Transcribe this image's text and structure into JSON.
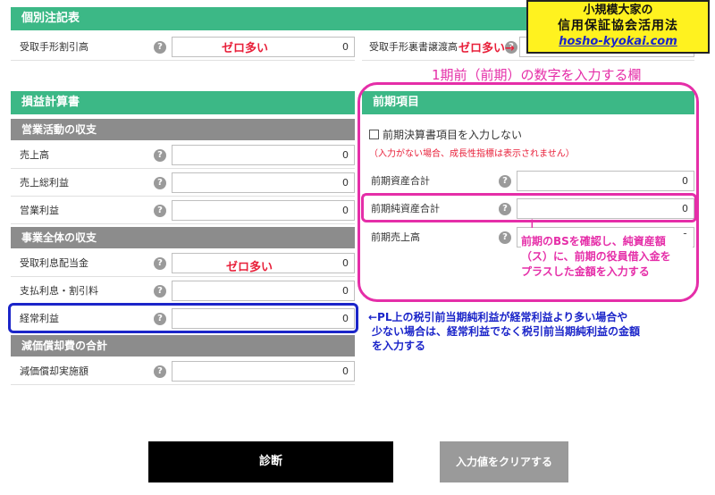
{
  "banner": {
    "line1": "小規模大家の",
    "line2": "信用保証協会活用法",
    "url": "hosho-kyokai.com"
  },
  "notes_section": {
    "title": "個別注記表",
    "rows": [
      {
        "label": "受取手形割引高",
        "value": "0",
        "annotation": "ゼロ多い"
      },
      {
        "label": "受取手形裏書譲渡高",
        "value": "",
        "annotation": "ゼロ多い"
      }
    ]
  },
  "income_statement": {
    "title": "損益計算書",
    "operating_header": "営業活動の収支",
    "operating_rows": [
      {
        "label": "売上高",
        "value": "0"
      },
      {
        "label": "売上総利益",
        "value": "0"
      },
      {
        "label": "営業利益",
        "value": "0"
      }
    ],
    "business_header": "事業全体の収支",
    "business_rows": [
      {
        "label": "受取利息配当金",
        "value": "0",
        "annotation": "ゼロ多い"
      },
      {
        "label": "支払利息・割引料",
        "value": "0"
      },
      {
        "label": "経常利益",
        "value": "0"
      }
    ],
    "depreciation_header": "減価償却費の合計",
    "depreciation_rows": [
      {
        "label": "減価償却実施額",
        "value": "0"
      }
    ]
  },
  "prior_period": {
    "caption": "1期前（前期）の数字を入力する欄",
    "title": "前期項目",
    "checkbox_label": "前期決算書項目を入力しない",
    "checkbox_note": "（入力がない場合、成長性指標は表示されません）",
    "rows": [
      {
        "label": "前期資産合計",
        "value": "0"
      },
      {
        "label": "前期純資産合計",
        "value": "0"
      },
      {
        "label": "前期売上高",
        "value": "0"
      }
    ],
    "arrow": "↑",
    "annotation_lines": [
      "前期のBSを確認し、純資産額",
      "（ス）に、前期の役員借入金を",
      "プラスした金額を入力する"
    ]
  },
  "ordinary_profit_note": {
    "lines": [
      "←PL上の税引前当期純利益が経常利益より多い場合や",
      "少ない場合は、経常利益でなく税引前当期純利益の金額",
      "を入力する"
    ]
  },
  "buttons": {
    "diagnose": "診断",
    "clear": "入力値をクリアする"
  },
  "colors": {
    "green": "#3cb886",
    "gray": "#8c8c8c",
    "magenta": "#e52ea8",
    "blue": "#1b25c9",
    "red": "#e8203a"
  }
}
